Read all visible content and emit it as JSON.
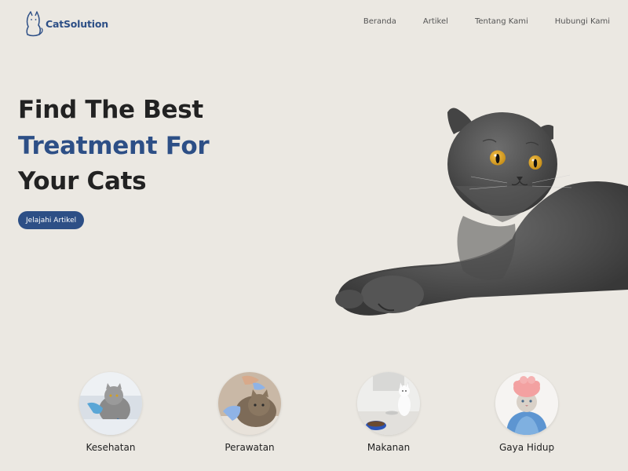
{
  "brand": {
    "name": "CatSolution",
    "logo_icon": "cat-outline-icon"
  },
  "nav": {
    "items": [
      {
        "label": "Beranda"
      },
      {
        "label": "Artikel"
      },
      {
        "label": "Tentang Kami"
      },
      {
        "label": "Hubungi Kami"
      }
    ]
  },
  "hero": {
    "line1": "Find The Best",
    "line2": "Treatment For",
    "line3": "Your Cats",
    "cta_label": "Jelajahi Artikel",
    "image": "gray-british-shorthair-cat-photo"
  },
  "categories": [
    {
      "label": "Kesehatan",
      "image": "cat-vet-checkup-photo"
    },
    {
      "label": "Perawatan",
      "image": "cat-grooming-photo"
    },
    {
      "label": "Makanan",
      "image": "cat-food-bowl-photo"
    },
    {
      "label": "Gaya Hidup",
      "image": "cat-in-towel-photo"
    }
  ],
  "colors": {
    "accent": "#2d4f86",
    "background": "#ebe8e2",
    "text": "#222222"
  }
}
